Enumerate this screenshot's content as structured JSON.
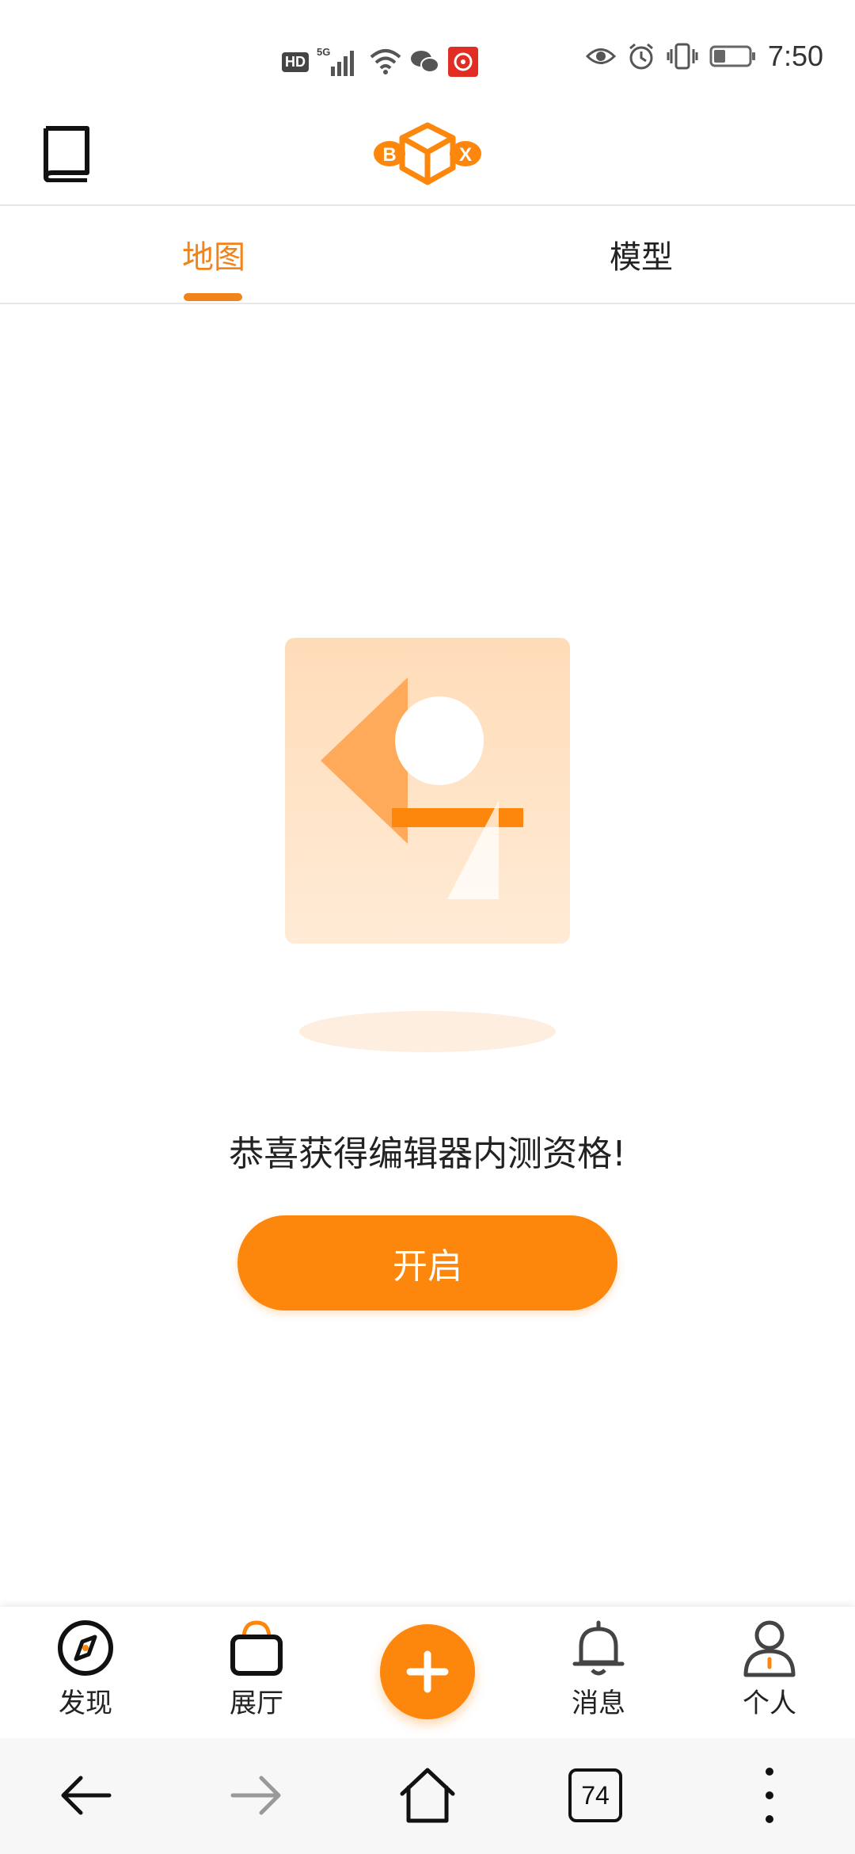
{
  "status_bar": {
    "time": "7:50",
    "hd": "HD",
    "network": "5G",
    "icons_left": [
      "hd-icon",
      "5g-signal-icon",
      "wifi-icon",
      "wechat-icon",
      "pinduoduo-icon"
    ],
    "icons_right": [
      "eye-icon",
      "alarm-icon",
      "vibrate-icon",
      "battery-icon"
    ]
  },
  "header": {
    "left_icon": "book-icon",
    "logo_letters": {
      "left": "B",
      "right": "X"
    }
  },
  "tabs": [
    {
      "label": "地图",
      "active": true
    },
    {
      "label": "模型",
      "active": false
    }
  ],
  "main": {
    "message": "恭喜获得编辑器内测资格!",
    "open_button": "开启"
  },
  "bottom_nav": {
    "items": [
      {
        "label": "发现",
        "icon": "compass-icon"
      },
      {
        "label": "展厅",
        "icon": "shopping-bag-icon"
      },
      {
        "label": "",
        "icon": "plus-icon"
      },
      {
        "label": "消息",
        "icon": "bell-icon"
      },
      {
        "label": "个人",
        "icon": "person-icon"
      }
    ]
  },
  "system_nav": {
    "tab_count": "74",
    "icons": [
      "back-arrow-icon",
      "forward-arrow-icon",
      "home-icon",
      "tabs-icon",
      "more-icon"
    ]
  },
  "colors": {
    "accent": "#fd860c",
    "tab_active": "#f0831a",
    "illustration_light": "#ffe3c4",
    "illustration_mid": "#ffb067"
  }
}
